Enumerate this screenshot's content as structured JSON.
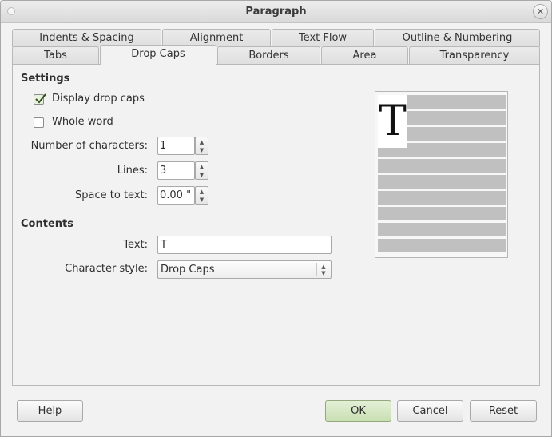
{
  "window": {
    "title": "Paragraph",
    "close_symbol": "✕"
  },
  "tabs_row1": [
    "Indents & Spacing",
    "Alignment",
    "Text Flow",
    "Outline & Numbering"
  ],
  "tabs_row2": [
    "Tabs",
    "Drop Caps",
    "Borders",
    "Area",
    "Transparency"
  ],
  "active_tab": "Drop Caps",
  "settings": {
    "section_title": "Settings",
    "display_drop_caps": {
      "label": "Display drop caps",
      "checked": true
    },
    "whole_word": {
      "label": "Whole word",
      "checked": false
    },
    "num_chars": {
      "label": "Number of characters:",
      "value": "1"
    },
    "lines": {
      "label": "Lines:",
      "value": "3"
    },
    "space_to_text": {
      "label": "Space to text:",
      "value": "0.00 \""
    }
  },
  "contents": {
    "section_title": "Contents",
    "text": {
      "label": "Text:",
      "value": "T"
    },
    "char_style": {
      "label": "Character style:",
      "value": "Drop Caps"
    }
  },
  "preview": {
    "drop_cap_letter": "T",
    "line_count": 10
  },
  "buttons": {
    "help": "Help",
    "ok": "OK",
    "cancel": "Cancel",
    "reset": "Reset"
  },
  "colors": {
    "accent": "#c9dfb3",
    "preview_line": "#c0c0c0"
  },
  "icons": {
    "check": "check-icon",
    "close": "close-icon",
    "spin_up": "spin-up-icon",
    "spin_down": "spin-down-icon"
  }
}
